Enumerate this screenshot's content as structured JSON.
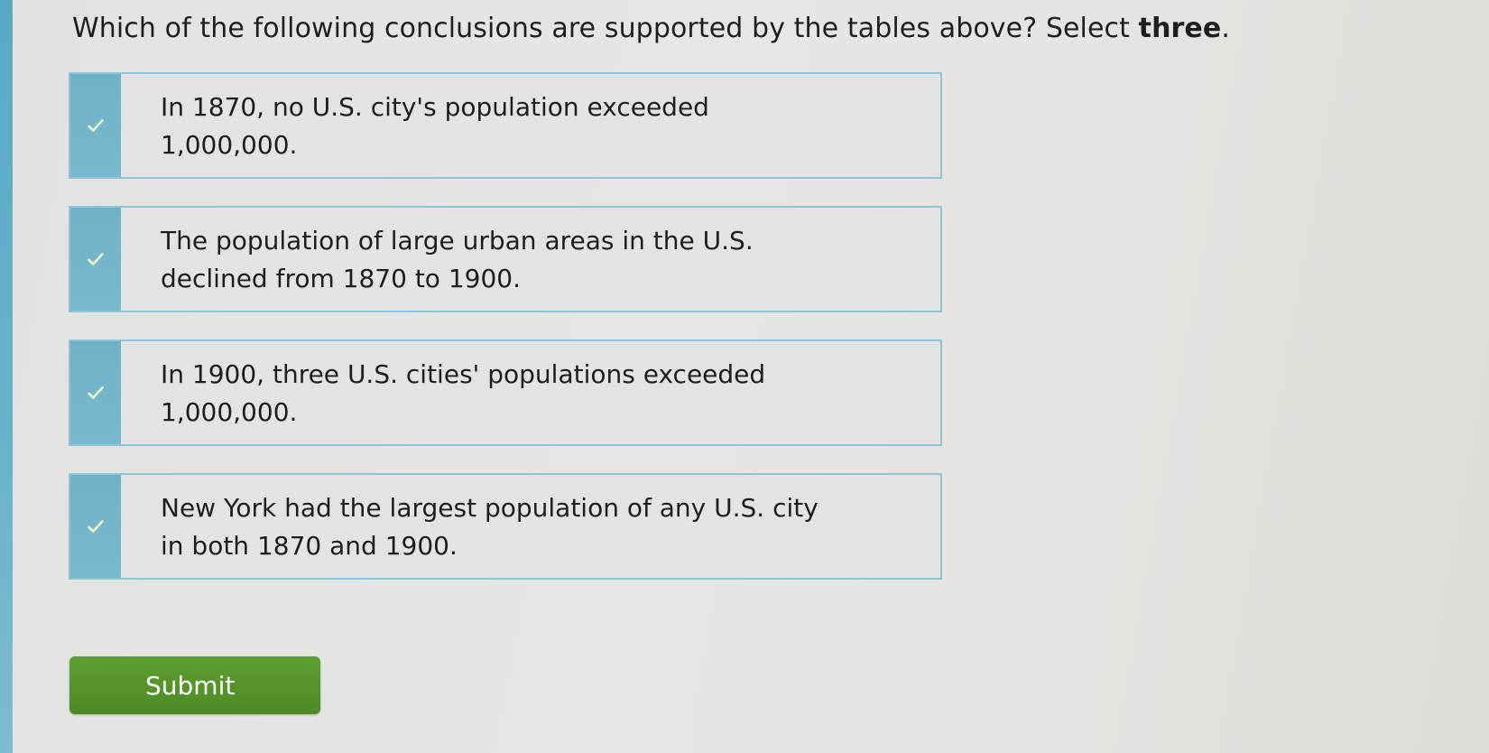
{
  "question": {
    "prefix": "Which of the following conclusions are supported by the tables above? Select ",
    "emphasis": "three",
    "suffix": "."
  },
  "options": [
    {
      "text": "In 1870, no U.S. city's population exceeded 1,000,000.",
      "icon": "check-icon"
    },
    {
      "text": "The population of large urban areas in the U.S. declined from 1870 to 1900.",
      "icon": "check-icon"
    },
    {
      "text": "In 1900, three U.S. cities' populations exceeded 1,000,000.",
      "icon": "check-icon"
    },
    {
      "text": "New York had the largest population of any U.S. city in both 1870 and 1900.",
      "icon": "check-icon"
    }
  ],
  "submit": {
    "label": "Submit"
  },
  "colors": {
    "accent": "#6fb2c8",
    "submit": "#5a982d",
    "border": "#8fc3d6"
  }
}
